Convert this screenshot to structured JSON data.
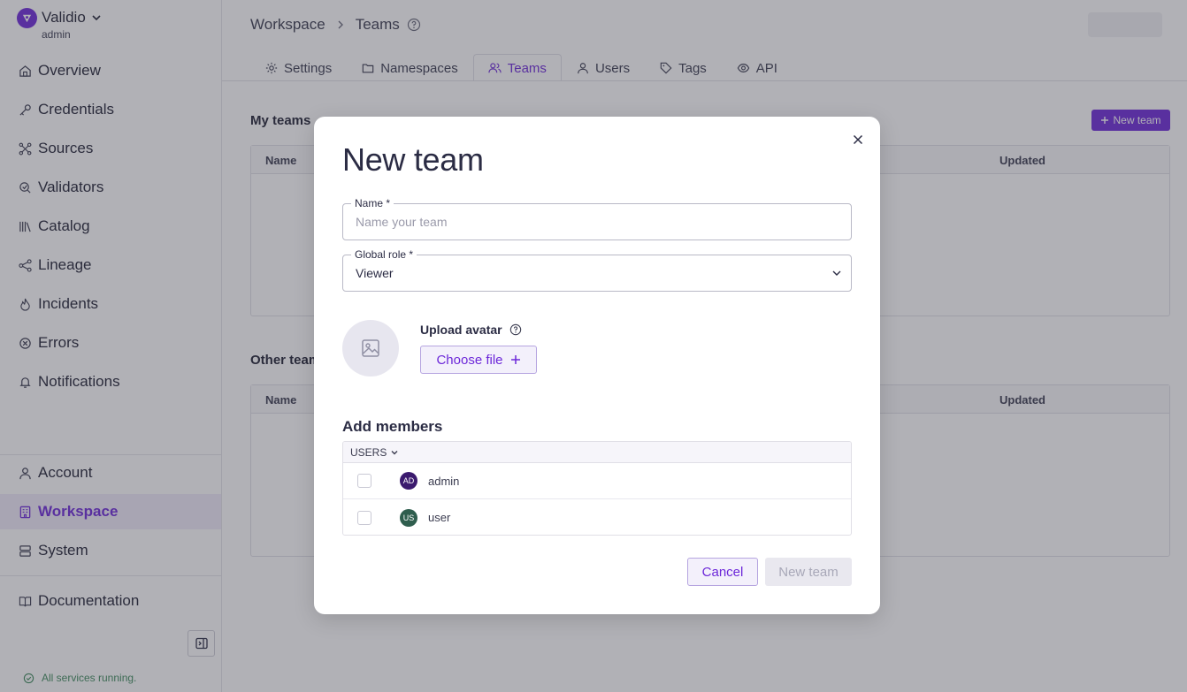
{
  "sidebar": {
    "brand": {
      "name": "Validio",
      "role": "admin"
    },
    "nav": [
      {
        "label": "Overview",
        "icon": "home-icon"
      },
      {
        "label": "Credentials",
        "icon": "key-icon"
      },
      {
        "label": "Sources",
        "icon": "sources-icon"
      },
      {
        "label": "Validators",
        "icon": "validators-icon"
      },
      {
        "label": "Catalog",
        "icon": "catalog-icon"
      },
      {
        "label": "Lineage",
        "icon": "lineage-icon"
      },
      {
        "label": "Incidents",
        "icon": "flame-icon"
      },
      {
        "label": "Errors",
        "icon": "error-icon"
      },
      {
        "label": "Notifications",
        "icon": "bell-icon"
      }
    ],
    "bottom_nav": [
      {
        "label": "Account",
        "icon": "user-icon"
      },
      {
        "label": "Workspace",
        "icon": "workspace-icon",
        "active": true
      },
      {
        "label": "System",
        "icon": "server-icon"
      }
    ],
    "documentation": "Documentation",
    "status": "All services running."
  },
  "breadcrumb": {
    "root": "Workspace",
    "current": "Teams"
  },
  "tabs": [
    {
      "label": "Settings",
      "icon": "gear-icon"
    },
    {
      "label": "Namespaces",
      "icon": "folder-icon"
    },
    {
      "label": "Teams",
      "icon": "users-icon",
      "active": true
    },
    {
      "label": "Users",
      "icon": "user-icon"
    },
    {
      "label": "Tags",
      "icon": "tag-icon"
    },
    {
      "label": "API",
      "icon": "eye-icon"
    }
  ],
  "page": {
    "my_teams_title": "My teams",
    "other_teams_title": "Other teams",
    "new_team_button": "New team",
    "columns": {
      "name": "Name",
      "updated": "Updated"
    }
  },
  "modal": {
    "title": "New team",
    "name_field": {
      "label": "Name *",
      "placeholder": "Name your team",
      "value": ""
    },
    "role_field": {
      "label": "Global role *",
      "value": "Viewer"
    },
    "upload": {
      "label": "Upload avatar",
      "button": "Choose file"
    },
    "members": {
      "title": "Add members",
      "filter": "USERS",
      "rows": [
        {
          "initials": "AD",
          "name": "admin",
          "color": "#3b1a6e",
          "checked": false
        },
        {
          "initials": "US",
          "name": "user",
          "color": "#2f5e4e",
          "checked": false
        }
      ]
    },
    "cancel": "Cancel",
    "submit": "New team"
  },
  "colors": {
    "accent": "#6d28d9",
    "status_ok": "#3f8a5d"
  }
}
